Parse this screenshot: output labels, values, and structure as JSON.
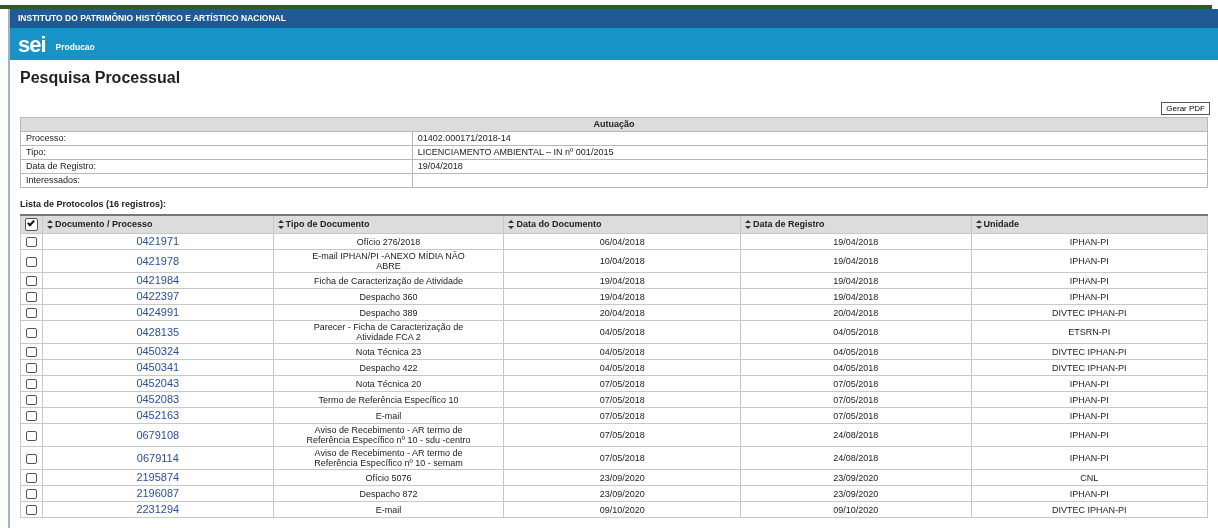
{
  "header": {
    "institution": "INSTITUTO DO PATRIMÔNIO HISTÓRICO E ARTÍSTICO NACIONAL",
    "logo": "sei",
    "environment": "Producao"
  },
  "page_title": "Pesquisa Processual",
  "pdf_button": "Gerar PDF",
  "autuacao": {
    "title": "Autuação",
    "rows": [
      {
        "label": "Processo:",
        "value": "01402.000171/2018-14"
      },
      {
        "label": "Tipo:",
        "value": "LICENCIAMENTO AMBIENTAL – IN nº 001/2015"
      },
      {
        "label": "Data de Registro:",
        "value": "19/04/2018"
      },
      {
        "label": "Interessados:",
        "value": ""
      }
    ]
  },
  "list_caption": "Lista de Protocolos (16 registros):",
  "table": {
    "select_all_checked": true,
    "columns": [
      "Documento / Processo",
      "Tipo de Documento",
      "Data do Documento",
      "Data de Registro",
      "Unidade"
    ],
    "rows": [
      {
        "checked": false,
        "documento": "0421971",
        "tipo": "Ofício 276/2018",
        "data_documento": "06/04/2018",
        "data_registro": "19/04/2018",
        "unidade": "IPHAN-PI"
      },
      {
        "checked": false,
        "documento": "0421978",
        "tipo": "E-mail IPHAN/PI -ANEXO MÍDIA NÃO ABRE",
        "data_documento": "10/04/2018",
        "data_registro": "19/04/2018",
        "unidade": "IPHAN-PI"
      },
      {
        "checked": false,
        "documento": "0421984",
        "tipo": "Ficha de Caracterização de Atividade",
        "data_documento": "19/04/2018",
        "data_registro": "19/04/2018",
        "unidade": "IPHAN-PI"
      },
      {
        "checked": false,
        "documento": "0422397",
        "tipo": "Despacho 360",
        "data_documento": "19/04/2018",
        "data_registro": "19/04/2018",
        "unidade": "IPHAN-PI"
      },
      {
        "checked": false,
        "documento": "0424991",
        "tipo": "Despacho 389",
        "data_documento": "20/04/2018",
        "data_registro": "20/04/2018",
        "unidade": "DIVTEC IPHAN-PI"
      },
      {
        "checked": false,
        "documento": "0428135",
        "tipo": "Parecer - Ficha de Caracterização de Atividade FCA 2",
        "data_documento": "04/05/2018",
        "data_registro": "04/05/2018",
        "unidade": "ETSRN-PI"
      },
      {
        "checked": false,
        "documento": "0450324",
        "tipo": "Nota Técnica 23",
        "data_documento": "04/05/2018",
        "data_registro": "04/05/2018",
        "unidade": "DIVTEC IPHAN-PI"
      },
      {
        "checked": false,
        "documento": "0450341",
        "tipo": "Despacho 422",
        "data_documento": "04/05/2018",
        "data_registro": "04/05/2018",
        "unidade": "DIVTEC IPHAN-PI"
      },
      {
        "checked": false,
        "documento": "0452043",
        "tipo": "Nota Técnica 20",
        "data_documento": "07/05/2018",
        "data_registro": "07/05/2018",
        "unidade": "IPHAN-PI"
      },
      {
        "checked": false,
        "documento": "0452083",
        "tipo": "Termo de Referência Específico 10",
        "data_documento": "07/05/2018",
        "data_registro": "07/05/2018",
        "unidade": "IPHAN-PI"
      },
      {
        "checked": false,
        "documento": "0452163",
        "tipo": "E-mail",
        "data_documento": "07/05/2018",
        "data_registro": "07/05/2018",
        "unidade": "IPHAN-PI"
      },
      {
        "checked": false,
        "documento": "0679108",
        "tipo": "Aviso de Recebimento - AR termo de Referência Específico nº 10 - sdu -centro",
        "data_documento": "07/05/2018",
        "data_registro": "24/08/2018",
        "unidade": "IPHAN-PI"
      },
      {
        "checked": false,
        "documento": "0679114",
        "tipo": "Aviso de Recebimento - AR termo de Referência Específico nº 10 - semam",
        "data_documento": "07/05/2018",
        "data_registro": "24/08/2018",
        "unidade": "IPHAN-PI"
      },
      {
        "checked": false,
        "documento": "2195874",
        "tipo": "Ofício 5076",
        "data_documento": "23/09/2020",
        "data_registro": "23/09/2020",
        "unidade": "CNL"
      },
      {
        "checked": false,
        "documento": "2196087",
        "tipo": "Despacho 872",
        "data_documento": "23/09/2020",
        "data_registro": "23/09/2020",
        "unidade": "IPHAN-PI"
      },
      {
        "checked": false,
        "documento": "2231294",
        "tipo": "E-mail",
        "data_documento": "09/10/2020",
        "data_registro": "09/10/2020",
        "unidade": "DIVTEC IPHAN-PI"
      }
    ]
  }
}
